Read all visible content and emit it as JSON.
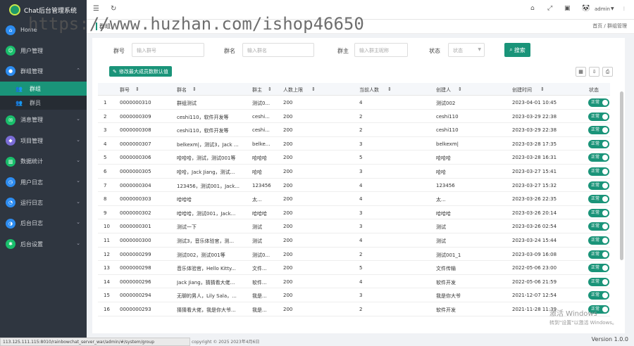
{
  "app": {
    "title": "Chat后台管理系统",
    "logo_icon": "chat-logo-icon"
  },
  "nav": [
    {
      "label": "Home",
      "color": "#2d8cf0",
      "has_chevron": false
    },
    {
      "label": "用户管理",
      "color": "#19be6b",
      "has_chevron": false
    },
    {
      "label": "群组管理",
      "color": "#2d8cf0",
      "has_chevron": true,
      "expanded": true
    },
    {
      "label": "消息管理",
      "color": "#19be6b",
      "has_chevron": true
    },
    {
      "label": "项目管理",
      "color": "#7a6cd6",
      "has_chevron": true
    },
    {
      "label": "数据统计",
      "color": "#19be6b",
      "has_chevron": true
    },
    {
      "label": "用户日志",
      "color": "#2d8cf0",
      "has_chevron": true
    },
    {
      "label": "运行日志",
      "color": "#2d8cf0",
      "has_chevron": true
    },
    {
      "label": "后台日志",
      "color": "#2d8cf0",
      "has_chevron": true
    },
    {
      "label": "后台设置",
      "color": "#19be6b",
      "has_chevron": true
    }
  ],
  "subnav": [
    {
      "label": "群组",
      "active": true
    },
    {
      "label": "群员",
      "active": false
    }
  ],
  "topbar": {
    "user": "admin"
  },
  "breadcrumb": {
    "tab": "群组",
    "path": "首页 / 群组管理"
  },
  "search": {
    "group_no_label": "群号",
    "group_no_placeholder": "输入群号",
    "group_name_label": "群名",
    "group_name_placeholder": "输入群名",
    "owner_label": "群主",
    "owner_placeholder": "输入群主昵称",
    "status_label": "状态",
    "status_value": "状态",
    "button": "搜索"
  },
  "toolbar": {
    "batch_button": "修改最大成员数默认值"
  },
  "table": {
    "columns": [
      "群号",
      "群名",
      "群主",
      "人数上限",
      "当前人数",
      "创建人",
      "创建时间",
      "状态"
    ],
    "rows": [
      [
        "1",
        "0000000310",
        "群组测试",
        "测试0...",
        "200",
        "4",
        "测试002",
        "2023-04-01 10:45",
        "正常"
      ],
      [
        "2",
        "0000000309",
        "ceshi110，软件开发等",
        "ceshi...",
        "200",
        "2",
        "ceshi110",
        "2023-03-29 22:38",
        "正常"
      ],
      [
        "3",
        "0000000308",
        "ceshi110，软件开发等",
        "ceshi...",
        "200",
        "2",
        "ceshi110",
        "2023-03-29 22:38",
        "正常"
      ],
      [
        "4",
        "0000000307",
        "belkexm|，测试3，Jack ...",
        "belke...",
        "200",
        "3",
        "belkexm|",
        "2023-03-28 17:35",
        "正常"
      ],
      [
        "5",
        "0000000306",
        "哈哈哈，测试，测试001等",
        "哈哈哈",
        "200",
        "5",
        "哈哈哈",
        "2023-03-28 16:31",
        "正常"
      ],
      [
        "6",
        "0000000305",
        "哈哈，Jack Jiang，测试...",
        "哈哈",
        "200",
        "3",
        "哈哈",
        "2023-03-27 15:41",
        "正常"
      ],
      [
        "7",
        "0000000304",
        "123456，测试001，Jack...",
        "123456",
        "200",
        "4",
        "123456",
        "2023-03-27 15:32",
        "正常"
      ],
      [
        "8",
        "0000000303",
        "哈哈哈",
        "太...",
        "200",
        "4",
        "太...",
        "2023-03-26 22:35",
        "正常"
      ],
      [
        "9",
        "0000000302",
        "哈哈哈，测试001，Jack...",
        "哈哈哈",
        "200",
        "3",
        "哈哈哈",
        "2023-03-26 20:14",
        "正常"
      ],
      [
        "10",
        "0000000301",
        "测试一下",
        "测试",
        "200",
        "3",
        "测试",
        "2023-03-26 02:54",
        "正常"
      ],
      [
        "11",
        "0000000300",
        "测试3，音乐体验官，测...",
        "测试",
        "200",
        "4",
        "测试",
        "2023-03-24 15:44",
        "正常"
      ],
      [
        "12",
        "0000000299",
        "测试002，测试001等",
        "测试0...",
        "200",
        "2",
        "测试001_1",
        "2023-03-09 16:08",
        "正常"
      ],
      [
        "13",
        "0000000298",
        "音乐体验官，Hello Kitty...",
        "文件...",
        "200",
        "5",
        "文件传输",
        "2022-05-06 23:00",
        "正常"
      ],
      [
        "14",
        "0000000296",
        "Jack Jiang，猜猜看大佬...",
        "软件...",
        "200",
        "4",
        "软件开发",
        "2022-05-06 21:59",
        "正常"
      ],
      [
        "15",
        "0000000294",
        "无聊的男人，Lily Sala，...",
        "我是...",
        "200",
        "3",
        "我是你大爷",
        "2021-12-07 12:54",
        "正常"
      ],
      [
        "16",
        "0000000293",
        "猜猜看大佬，我是你大爷...",
        "我是...",
        "200",
        "2",
        "软件开发",
        "2021-11-28 11:39",
        "正常"
      ]
    ]
  },
  "status_url": "113.125.111.115:8010/rainbowchat_server_war/admin/#/system/group",
  "copyright": "copyright © 2025  2023年4月6日",
  "version": "Version 1.0.0",
  "watermark": "https://www.huzhan.com/ishop46650",
  "windows_activate": [
    "激活 Windows",
    "转到\"设置\"以激活 Windows。"
  ],
  "colors": {
    "accent": "#1a9479",
    "sidebar": "#2f3640"
  }
}
